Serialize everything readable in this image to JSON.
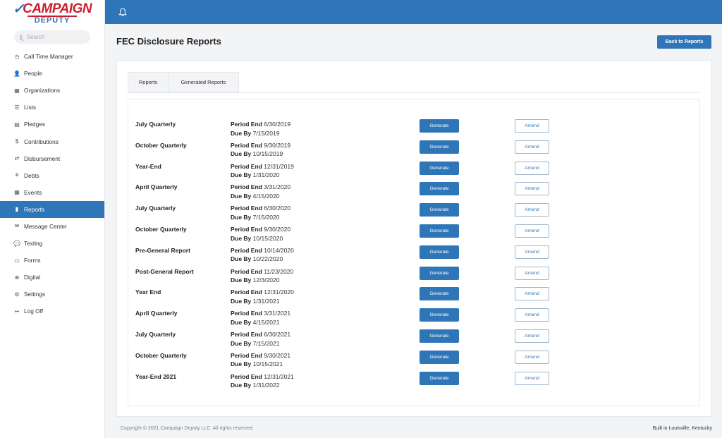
{
  "brand": {
    "top": "CAMPAIGN",
    "bottom": "DEPUTY"
  },
  "search": {
    "placeholder": "Search"
  },
  "nav": [
    {
      "label": "Call Time Manager",
      "icon": "clock-icon",
      "glyph": "◷"
    },
    {
      "label": "People",
      "icon": "person-icon",
      "glyph": "👤"
    },
    {
      "label": "Organizations",
      "icon": "building-icon",
      "glyph": "▦"
    },
    {
      "label": "Lists",
      "icon": "list-icon",
      "glyph": "☰"
    },
    {
      "label": "Pledges",
      "icon": "pledge-icon",
      "glyph": "▤"
    },
    {
      "label": "Contributions",
      "icon": "dollar-icon",
      "glyph": "$"
    },
    {
      "label": "Disbursement",
      "icon": "exchange-icon",
      "glyph": "⇄"
    },
    {
      "label": "Debts",
      "icon": "handshake-icon",
      "glyph": "⚘"
    },
    {
      "label": "Events",
      "icon": "calendar-icon",
      "glyph": "▦"
    },
    {
      "label": "Reports",
      "icon": "file-icon",
      "glyph": "▮",
      "active": true
    },
    {
      "label": "Message Center",
      "icon": "envelope-icon",
      "glyph": "✉"
    },
    {
      "label": "Texting",
      "icon": "chat-icon",
      "glyph": "💬"
    },
    {
      "label": "Forms",
      "icon": "form-icon",
      "glyph": "▭"
    },
    {
      "label": "Digital",
      "icon": "globe-icon",
      "glyph": "⊕"
    },
    {
      "label": "Settings",
      "icon": "gear-icon",
      "glyph": "⚙"
    },
    {
      "label": "Log Off",
      "icon": "logout-icon",
      "glyph": "↦"
    }
  ],
  "page": {
    "title": "FEC Disclosure Reports",
    "back_label": "Back to Reports"
  },
  "tabs": [
    {
      "label": "Reports"
    },
    {
      "label": "Generated Reports"
    }
  ],
  "labels": {
    "period_end": "Period End",
    "due_by": "Due By",
    "generate": "Generate",
    "amend": "Amend"
  },
  "reports": [
    {
      "name": "July Quarterly",
      "period_end": "6/30/2019",
      "due_by": "7/15/2019"
    },
    {
      "name": "October Quarterly",
      "period_end": "9/30/2019",
      "due_by": "10/15/2019"
    },
    {
      "name": "Year-End",
      "period_end": "12/31/2019",
      "due_by": "1/31/2020"
    },
    {
      "name": "April Quarterly",
      "period_end": "3/31/2020",
      "due_by": "4/15/2020"
    },
    {
      "name": "July Quarterly",
      "period_end": "6/30/2020",
      "due_by": "7/15/2020"
    },
    {
      "name": "October Quarterly",
      "period_end": "9/30/2020",
      "due_by": "10/15/2020"
    },
    {
      "name": "Pre-General Report",
      "period_end": "10/14/2020",
      "due_by": "10/22/2020"
    },
    {
      "name": "Post-General Report",
      "period_end": "11/23/2020",
      "due_by": "12/3/2020"
    },
    {
      "name": "Year End",
      "period_end": "12/31/2020",
      "due_by": "1/31/2021"
    },
    {
      "name": "April Quarterly",
      "period_end": "3/31/2021",
      "due_by": "4/15/2021"
    },
    {
      "name": "July Quarterly",
      "period_end": "6/30/2021",
      "due_by": "7/15/2021"
    },
    {
      "name": "October Quarterly",
      "period_end": "9/30/2021",
      "due_by": "10/15/2021"
    },
    {
      "name": "Year-End 2021",
      "period_end": "12/31/2021",
      "due_by": "1/31/2022"
    }
  ],
  "footer": {
    "copyright": "Copyright © 2021 Campaign Deputy LLC. All rights reserved.",
    "built": "Built in Louisville, Kentucky"
  },
  "colors": {
    "primary": "#2f76b9",
    "brand_red": "#c8202f"
  }
}
